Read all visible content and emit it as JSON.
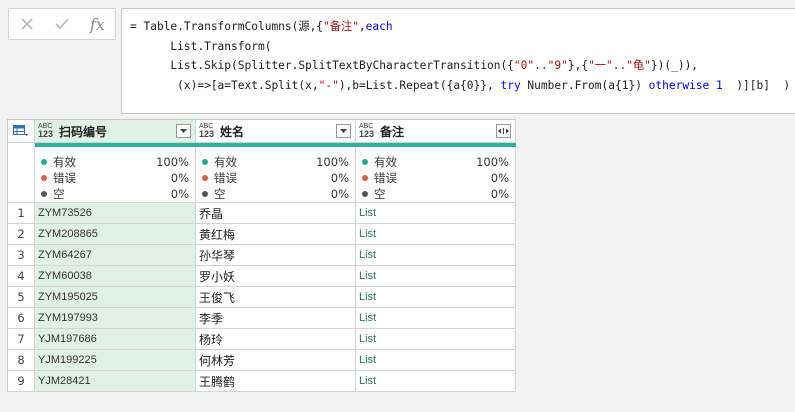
{
  "formula_bar": {
    "cancel_icon": "x-icon",
    "confirm_icon": "checkmark-icon",
    "fx_label": "fx",
    "lines": [
      [
        {
          "t": "= Table.TransformColumns(源,{",
          "c": ""
        },
        {
          "t": "\"备注\"",
          "c": "s"
        },
        {
          "t": ",",
          "c": ""
        },
        {
          "t": "each",
          "c": "k"
        }
      ],
      [
        {
          "t": "      List.Transform(",
          "c": ""
        }
      ],
      [
        {
          "t": "      List.Skip(Splitter.SplitTextByCharacterTransition({",
          "c": ""
        },
        {
          "t": "\"0\"",
          "c": "s"
        },
        {
          "t": "..",
          "c": ""
        },
        {
          "t": "\"9\"",
          "c": "s"
        },
        {
          "t": "},{",
          "c": ""
        },
        {
          "t": "\"一\"",
          "c": "s"
        },
        {
          "t": "..",
          "c": ""
        },
        {
          "t": "\"龟\"",
          "c": "s"
        },
        {
          "t": "})(_)),",
          "c": ""
        }
      ],
      [
        {
          "t": "       (x)=>[a=Text.Split(x,",
          "c": ""
        },
        {
          "t": "\"-\"",
          "c": "s"
        },
        {
          "t": "),b=List.Repeat({a{0}}, ",
          "c": ""
        },
        {
          "t": "try",
          "c": "k"
        },
        {
          "t": " Number.From(a{1}) ",
          "c": ""
        },
        {
          "t": "otherwise",
          "c": "k"
        },
        {
          "t": " ",
          "c": ""
        },
        {
          "t": "1",
          "c": "k"
        },
        {
          "t": "  )][b]  )   })",
          "c": ""
        }
      ]
    ]
  },
  "table": {
    "corner_icon": "table-icon",
    "columns": [
      {
        "name": "扫码编号",
        "type_top": "ABC",
        "type_bottom": "123",
        "button_icon": "chevron-down-icon"
      },
      {
        "name": "姓名",
        "type_top": "ABC",
        "type_bottom": "123",
        "button_icon": "chevron-down-icon"
      },
      {
        "name": "备注",
        "type_top": "ABC",
        "type_bottom": "123",
        "button_icon": "expand-icon"
      }
    ],
    "quality": {
      "labels": {
        "valid": "有效",
        "error": "错误",
        "empty": "空"
      },
      "colors": {
        "valid": "#27a890",
        "error": "#e05a50",
        "empty": "#555555"
      },
      "stats": [
        {
          "valid": "100%",
          "error": "0%",
          "empty": "0%"
        },
        {
          "valid": "100%",
          "error": "0%",
          "empty": "0%"
        },
        {
          "valid": "100%",
          "error": "0%",
          "empty": "0%"
        }
      ]
    },
    "rows": [
      {
        "num": "1",
        "code": "ZYM73526",
        "name": "乔晶",
        "note": "List"
      },
      {
        "num": "2",
        "code": "ZYM208865",
        "name": "黄红梅",
        "note": "List"
      },
      {
        "num": "3",
        "code": "ZYM64267",
        "name": "孙华琴",
        "note": "List"
      },
      {
        "num": "4",
        "code": "ZYM60038",
        "name": "罗小妖",
        "note": "List"
      },
      {
        "num": "5",
        "code": "ZYM195025",
        "name": "王俊飞",
        "note": "List"
      },
      {
        "num": "6",
        "code": "ZYM197993",
        "name": "李季",
        "note": "List"
      },
      {
        "num": "7",
        "code": "YJM197686",
        "name": "杨玲",
        "note": "List"
      },
      {
        "num": "8",
        "code": "YJM199225",
        "name": "何林芳",
        "note": "List"
      },
      {
        "num": "9",
        "code": "YJM28421",
        "name": "王腾鹤",
        "note": "List"
      }
    ]
  },
  "colors": {
    "accent_bar": "#2bb3a0",
    "selected_column": "#dff0e6",
    "list_link": "#2d7a4e"
  }
}
